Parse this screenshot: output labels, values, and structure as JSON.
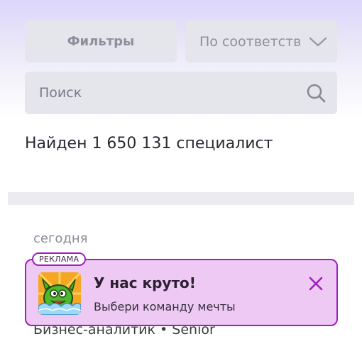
{
  "toolbar": {
    "filters_label": "Фильтры",
    "sort_value": "По соответствию"
  },
  "search": {
    "placeholder": "Поиск"
  },
  "results": {
    "count_text": "Найден 1 650 131 специалист"
  },
  "list": {
    "date_label": "сегодня",
    "first_item_title": "Бизнес-аналитик • Senior"
  },
  "ad": {
    "badge": "РЕКЛАМА",
    "title": "У нас круто!",
    "subtitle": "Выбери команду мечты",
    "accent_color": "#a21ec0",
    "background_color": "#edc9f3",
    "logo_icon": "green-monster-logo",
    "close_icon": "close-icon"
  },
  "colors": {
    "button_bg": "#e5e5ec",
    "header_gradient_top": "#ddd6fb"
  }
}
